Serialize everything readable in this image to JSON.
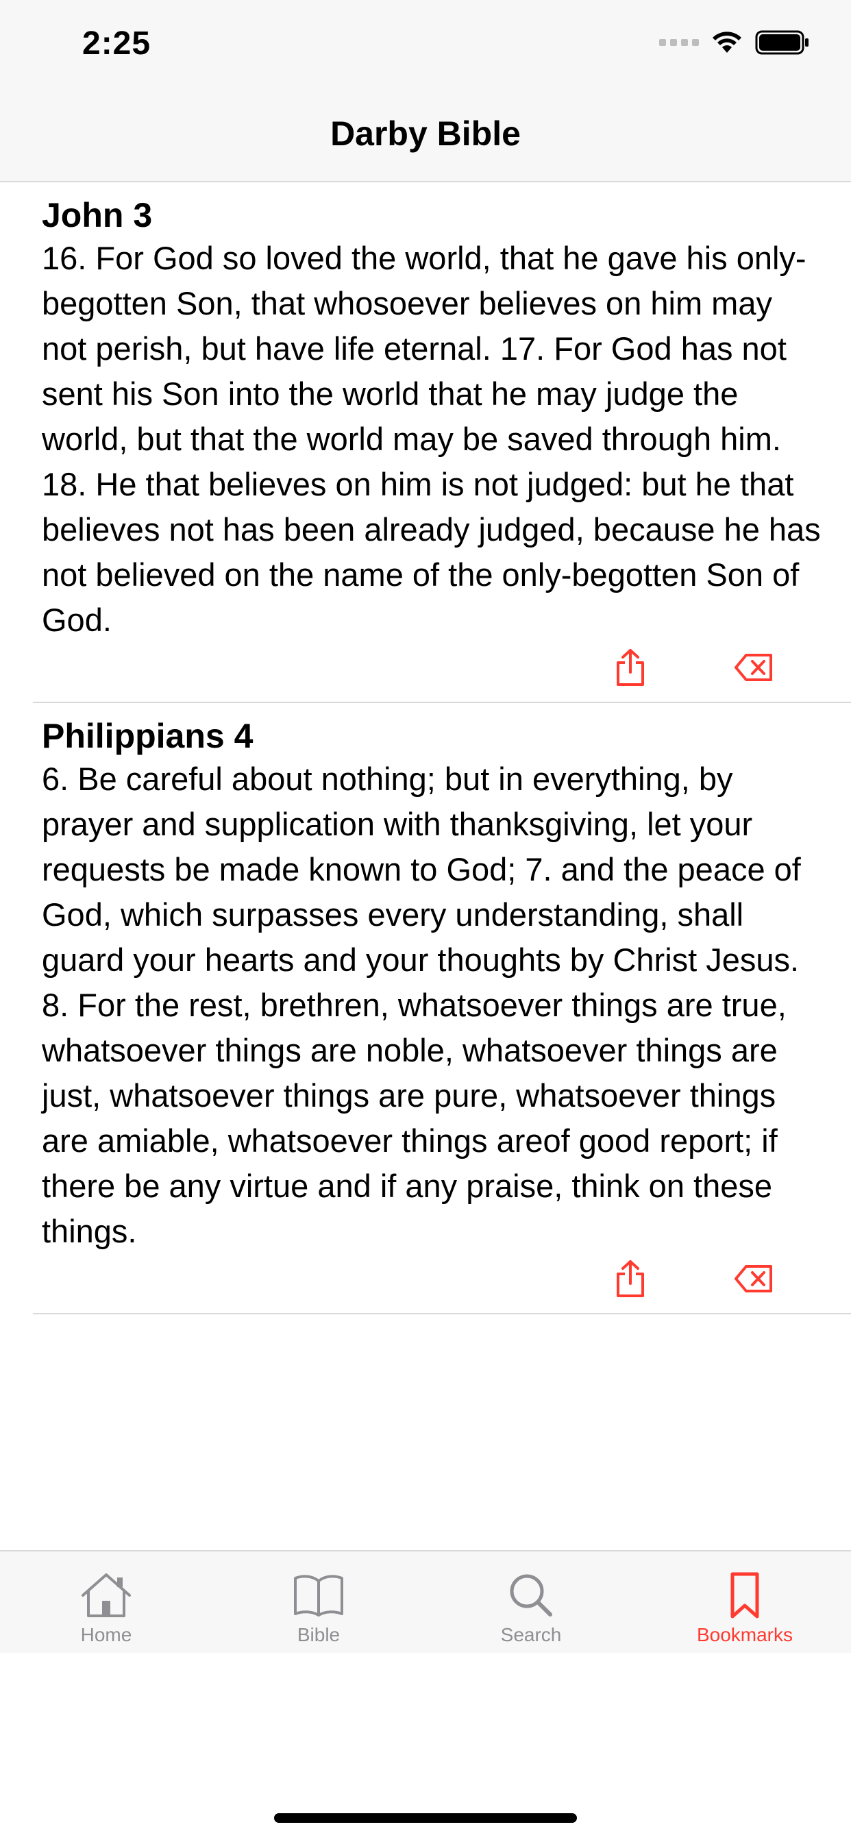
{
  "status_bar": {
    "time": "2:25"
  },
  "nav": {
    "title": "Darby Bible"
  },
  "bookmarks": [
    {
      "reference": "John 3",
      "text": "16. For God so loved the world, that he gave his only-begotten Son, that whosoever believes on him may not perish, but have life eternal. 17. For God has not sent his Son into the world that he may judge the world, but that the world may be saved through him. 18. He that believes on him is not judged: but he that believes not has been already judged, because he has not believed on the name of the only-begotten Son of God."
    },
    {
      "reference": "Philippians 4",
      "text": "6. Be careful about nothing; but in everything, by prayer and supplication with thanksgiving, let your requests be made known to God; 7. and the peace of God, which surpasses every understanding, shall guard your hearts and your thoughts by Christ Jesus. 8. For the rest, brethren, whatsoever things are true, whatsoever things are noble, whatsoever things are just, whatsoever things are pure, whatsoever things are amiable, whatsoever things areof good report; if there be any virtue and if any praise, think on these things."
    }
  ],
  "tabs": [
    {
      "label": "Home",
      "icon": "house-icon",
      "active": false
    },
    {
      "label": "Bible",
      "icon": "book-icon",
      "active": false
    },
    {
      "label": "Search",
      "icon": "magnifier-icon",
      "active": false
    },
    {
      "label": "Bookmarks",
      "icon": "bookmark-icon",
      "active": true
    }
  ],
  "colors": {
    "accent": "#ff3b30",
    "inactive_tab": "#8e8e93",
    "bar_background": "#f7f7f7",
    "separator": "#d9d9d9"
  }
}
